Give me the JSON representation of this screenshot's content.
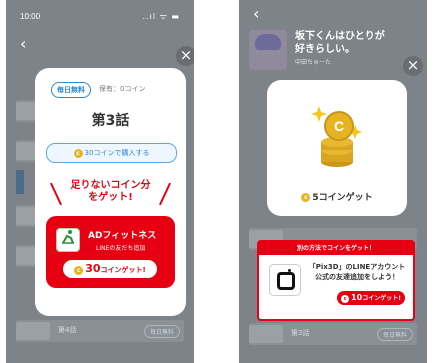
{
  "left": {
    "status_time": "10:00",
    "status_icons": "..ıl ᯤ ▬",
    "back_icon": "‹",
    "close_icon": "×",
    "daily_badge": "毎日無料",
    "holding": "保有：0コイン",
    "episode": "第3話",
    "coin_symbol": "c",
    "buy_label": "30コインで購入する",
    "headline_line1": "足りないコイン分",
    "headline_line2": "をゲット!",
    "ad_title": "ADフィットネス",
    "ad_sub": "LINEの友だち追加",
    "ad_button_amount": "30",
    "ad_button_suffix": "コインゲット!",
    "bg_row_label": "第4話",
    "bg_row_badge": "毎日無料"
  },
  "right": {
    "back_icon": "‹",
    "close_icon": "×",
    "story_title_line1": "坂下くんはひとりが",
    "story_title_line2": "好きらしい。",
    "author": "中田ちゅーた",
    "reward_label": "5コインゲット",
    "coin_symbol": "c",
    "other_way_header": "別の方法でコインをゲット！",
    "line_text_line1": "「Pix3D」のLINEアカウント",
    "line_text_line2": "公式の友達追加をしよう！",
    "line_button_amount": "10",
    "line_button_suffix": "コインゲット!",
    "bg_row_label": "第3話",
    "bg_row_badge": "毎日無料"
  },
  "colors": {
    "accent_red": "#e60012",
    "accent_blue": "#2d8ad1",
    "coin_gold": "#e6b422",
    "overlay": "#7d8388"
  }
}
